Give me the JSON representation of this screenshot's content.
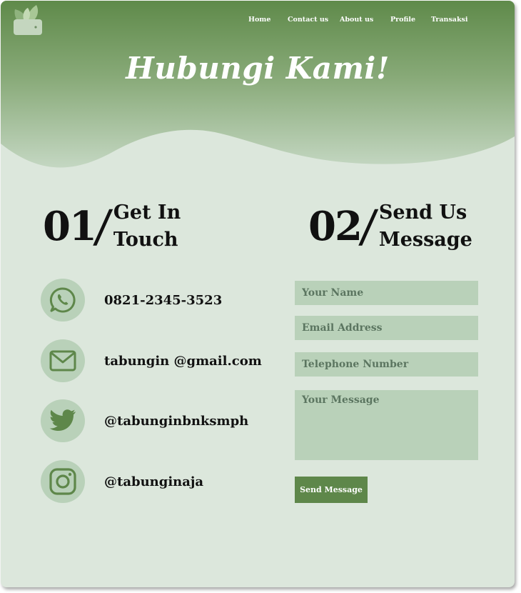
{
  "nav": {
    "items": [
      "Home",
      "Contact us",
      "About us",
      "Profile",
      "Transaksi"
    ]
  },
  "hero": {
    "title": "Hubungi Kami!"
  },
  "colors": {
    "primary_green": "#5e874a",
    "light_green": "#b9d1b9",
    "background": "#dce7dc"
  },
  "sections": {
    "left": {
      "number": "01",
      "title_line1": "Get In",
      "title_line2": "Touch"
    },
    "right": {
      "number": "02",
      "title_line1": "Send Us",
      "title_line2": "Message"
    }
  },
  "contacts": [
    {
      "icon": "whatsapp-icon",
      "text": "0821-2345-3523"
    },
    {
      "icon": "mail-icon",
      "text": "tabungin @gmail.com"
    },
    {
      "icon": "twitter-icon",
      "text": "@tabunginbnksmph"
    },
    {
      "icon": "instagram-icon",
      "text": "@tabunginaja"
    }
  ],
  "form": {
    "name_placeholder": "Your Name",
    "email_placeholder": "Email Address",
    "phone_placeholder": "Telephone Number",
    "message_placeholder": "Your Message",
    "submit_label": "Send Message"
  }
}
